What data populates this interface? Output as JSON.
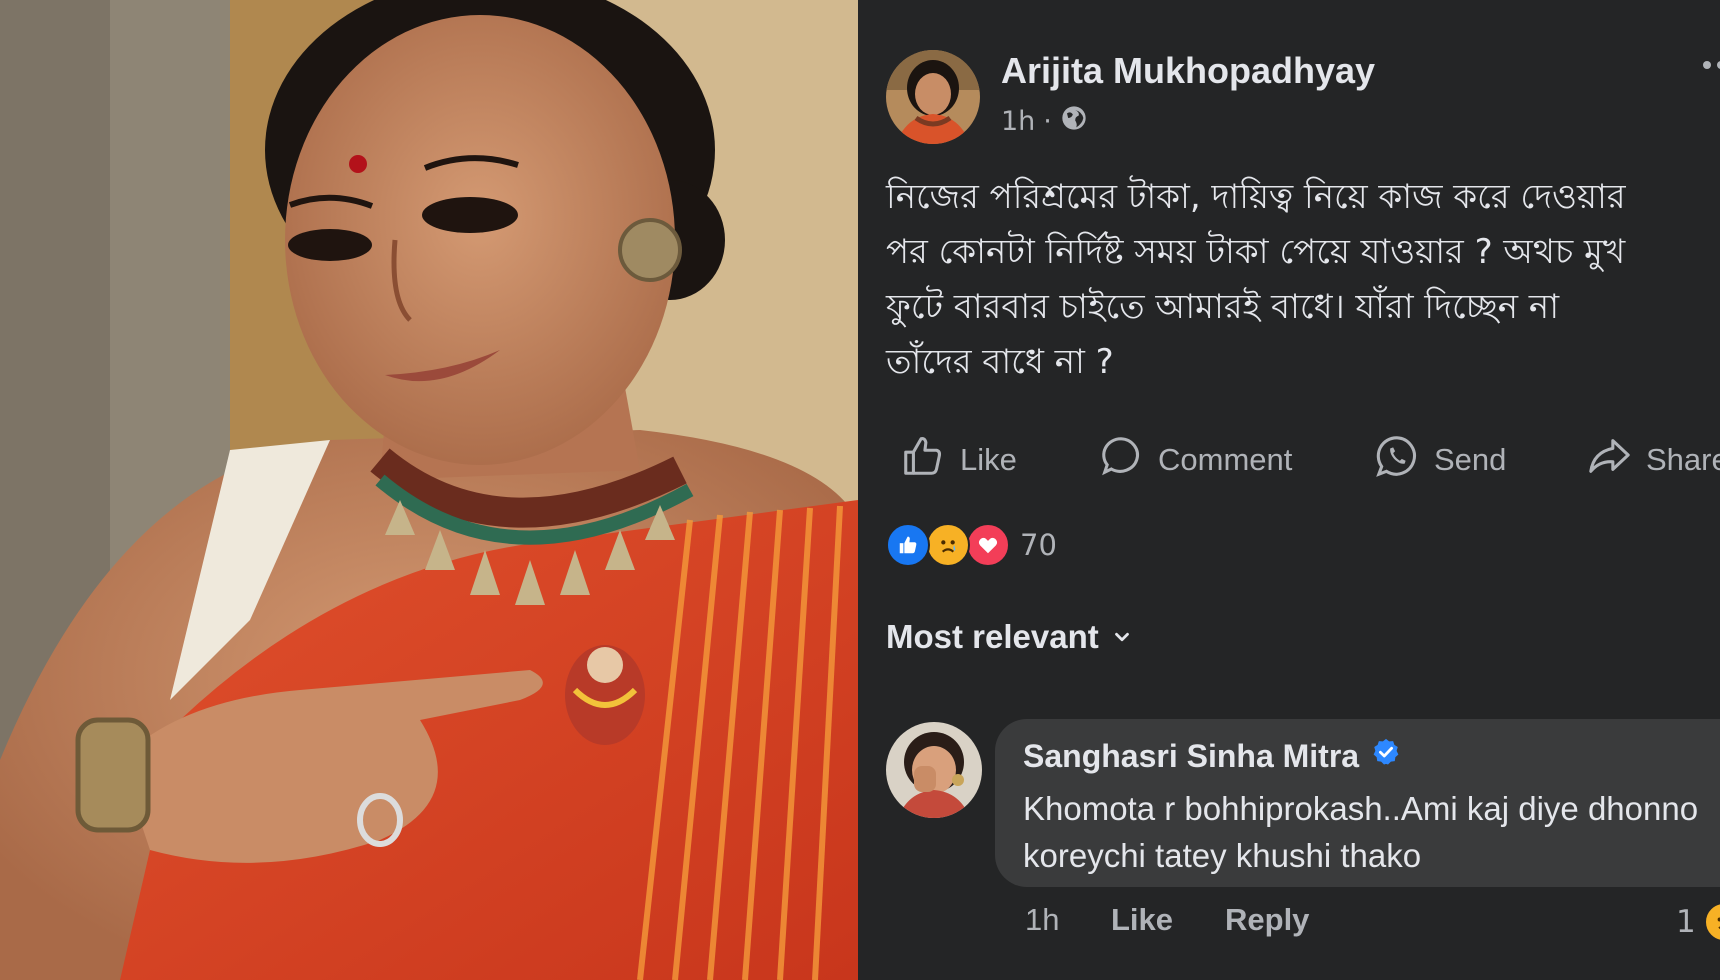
{
  "post": {
    "author": "Arijita Mukhopadhyay",
    "time": "1h",
    "separator": "·",
    "privacy_icon": "globe-icon",
    "text": "নিজের পরিশ্রমের টাকা, দায়িত্ব নিয়ে কাজ করে দেওয়ার\nপর কোনটা নির্দিষ্ট সময় টাকা পেয়ে যাওয়ার ?  অথচ মুখ\nফুটে বারবার চাইতে আমারই  বাধে। যাঁরা দিচ্ছেন না\nতাঁদের বাধে না ?"
  },
  "actions": {
    "like": "Like",
    "comment": "Comment",
    "send": "Send",
    "share": "Share"
  },
  "reactions": {
    "types": [
      "like-reaction-icon",
      "sad-reaction-icon",
      "love-reaction-icon"
    ],
    "count": "70"
  },
  "comments_sort": "Most relevant",
  "comment": {
    "author": "Sanghasri Sinha Mitra",
    "verified": true,
    "text": "Khomota r bohhiprokash..Ami kaj diye dhonno koreychi tatey khushi thako",
    "time": "1h",
    "like": "Like",
    "reply": "Reply",
    "reaction_count": "1",
    "reaction_icon": "sad-reaction-icon"
  },
  "colors": {
    "panel_bg": "#242526",
    "bubble_bg": "#3a3b3c",
    "primary_text": "#e4e6eb",
    "secondary_text": "#b0b3b8",
    "verified_blue": "#2d88ff",
    "like_blue": "#1877f2",
    "love_red": "#f33e58",
    "sad_yellow": "#f7b125"
  }
}
